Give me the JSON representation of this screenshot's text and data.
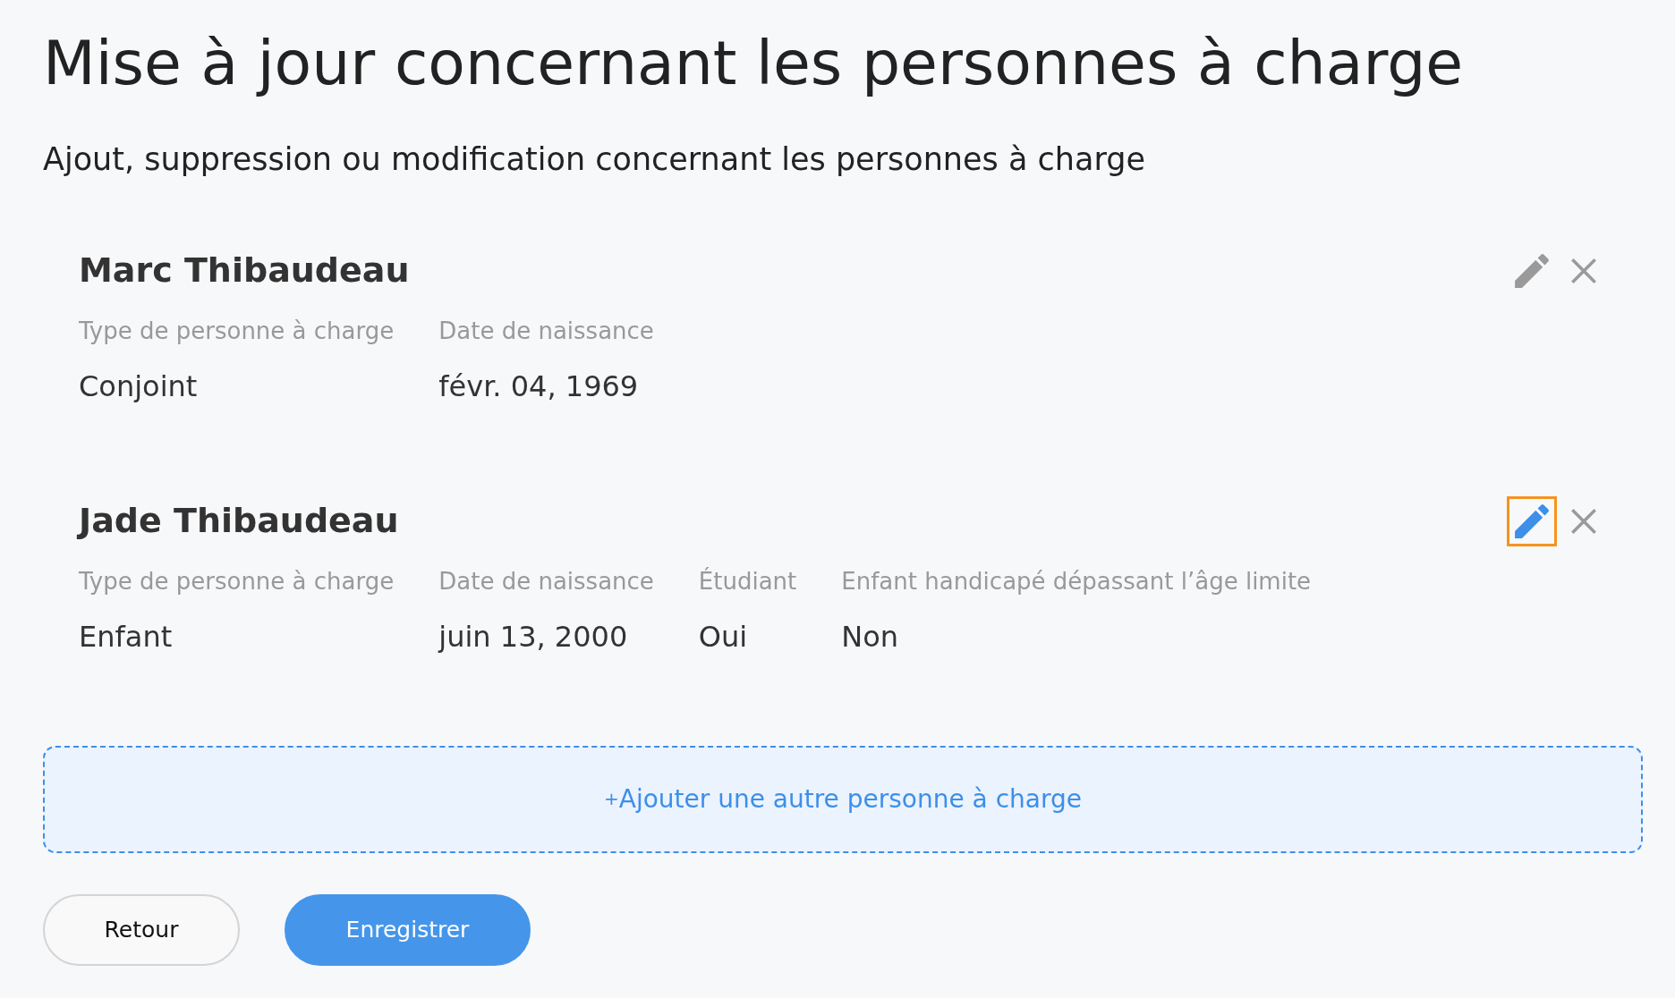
{
  "title": "Mise à jour concernant les personnes à charge",
  "subtitle": "Ajout, suppression ou modification concernant les personnes à charge",
  "dependents": [
    {
      "name": "Marc Thibaudeau",
      "edit_focused": false,
      "fields": [
        {
          "label": "Type de personne à charge",
          "value": "Conjoint"
        },
        {
          "label": "Date de naissance",
          "value": "févr. 04, 1969"
        }
      ]
    },
    {
      "name": "Jade Thibaudeau",
      "edit_focused": true,
      "fields": [
        {
          "label": "Type de personne à charge",
          "value": "Enfant"
        },
        {
          "label": "Date de naissance",
          "value": "juin 13, 2000"
        },
        {
          "label": "Étudiant",
          "value": "Oui"
        },
        {
          "label": "Enfant handicapé dépassant l’âge limite",
          "value": "Non"
        }
      ]
    }
  ],
  "add_button": {
    "icon": "+",
    "label": "Ajouter une autre personne à charge"
  },
  "buttons": [
    {
      "label": "Retour",
      "kind": "secondary"
    },
    {
      "label": "Enregistrer",
      "kind": "primary"
    }
  ]
}
